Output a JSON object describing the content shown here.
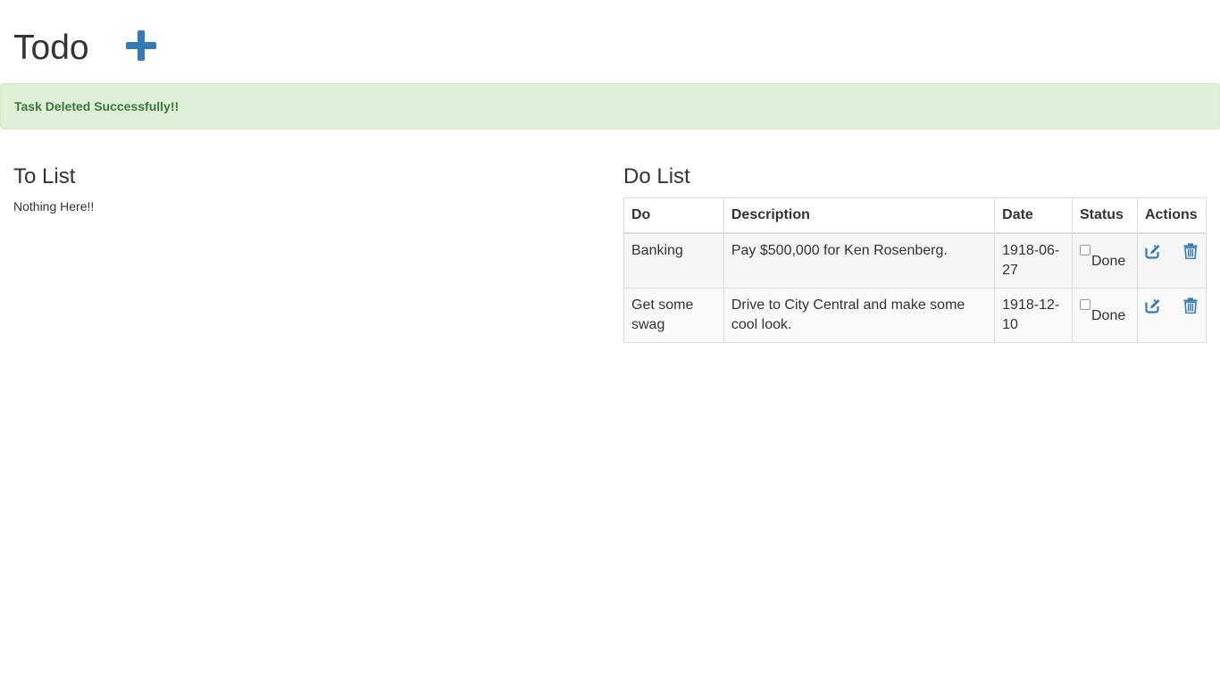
{
  "header": {
    "title": "Todo",
    "add_icon": "plus-icon",
    "accent_color": "#337ab7"
  },
  "alert": {
    "message": "Task Deleted Successfully!!",
    "background": "#dff0d8",
    "text_color": "#3c763d"
  },
  "to_list": {
    "title": "To List",
    "empty_text": "Nothing Here!!"
  },
  "do_list": {
    "title": "Do List",
    "columns": [
      "Do",
      "Description",
      "Date",
      "Status",
      "Actions"
    ],
    "rows": [
      {
        "do": "Banking",
        "description": "Pay $500,000 for Ken Rosenberg.",
        "date": "1918-06-27",
        "status_label": "Done",
        "checked": false
      },
      {
        "do": "Get some swag",
        "description": "Drive to City Central and make some cool look.",
        "date": "1918-12-10",
        "status_label": "Done",
        "checked": false
      }
    ],
    "action_icons": [
      "edit-icon",
      "trash-icon"
    ]
  }
}
